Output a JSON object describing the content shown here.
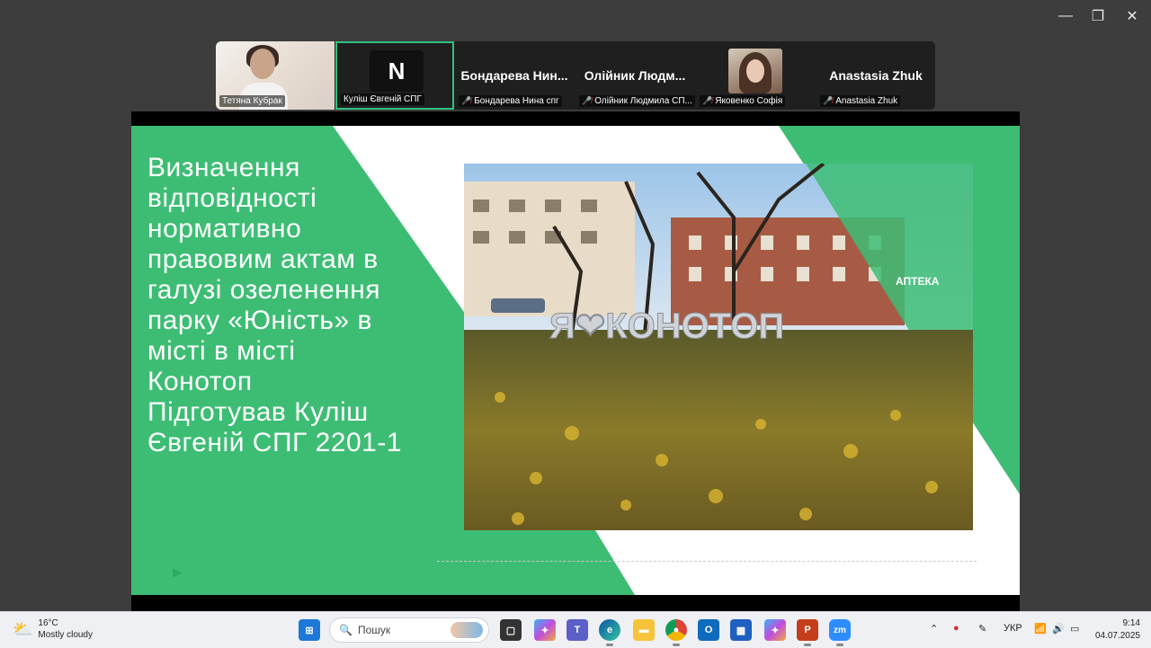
{
  "window": {
    "minimize": "—",
    "restore": "❐",
    "close": "✕"
  },
  "participants": [
    {
      "label": "Тетяна Кубрак",
      "muted": false
    },
    {
      "label": "Куліш Євгеній СПГ",
      "muted": false,
      "logo": "N",
      "active": true
    },
    {
      "name_display": "Бондарева Нин...",
      "label": "Бондарева Нина спг",
      "muted": true
    },
    {
      "name_display": "Олійник Людм...",
      "label": "Олійник Людмила СП...",
      "muted": true
    },
    {
      "label": "Яковенко Софія",
      "muted": true
    },
    {
      "name_display": "Anastasia Zhuk",
      "label": "Anastasia Zhuk",
      "muted": true
    }
  ],
  "slide": {
    "title": "Визначення\nвідповідності\nнормативно\nправовим актам в\nгалузі озеленення\nпарку «Юність» в\nмісті в місті\nКонотоп\nПідготував Куліш\nЄвгеній СПГ 2201-1",
    "photo_sign": "Я❤КОНОТОП",
    "photo_shop_sign": "АПТЕКА",
    "accent_color": "#3dbd74"
  },
  "taskbar": {
    "weather_temp": "16°C",
    "weather_desc": "Mostly cloudy",
    "search_placeholder": "Пошук",
    "lang": "УКР",
    "time": "9:14",
    "date": "04.07.2025",
    "apps": [
      "start-icon",
      "search-decor",
      "file-explorer-icon",
      "copilot-icon",
      "teams-icon",
      "edge-icon",
      "folder-icon",
      "chrome-icon",
      "outlook-icon",
      "store-icon",
      "copilot-app-icon",
      "powerpoint-icon",
      "zoom-icon"
    ]
  }
}
